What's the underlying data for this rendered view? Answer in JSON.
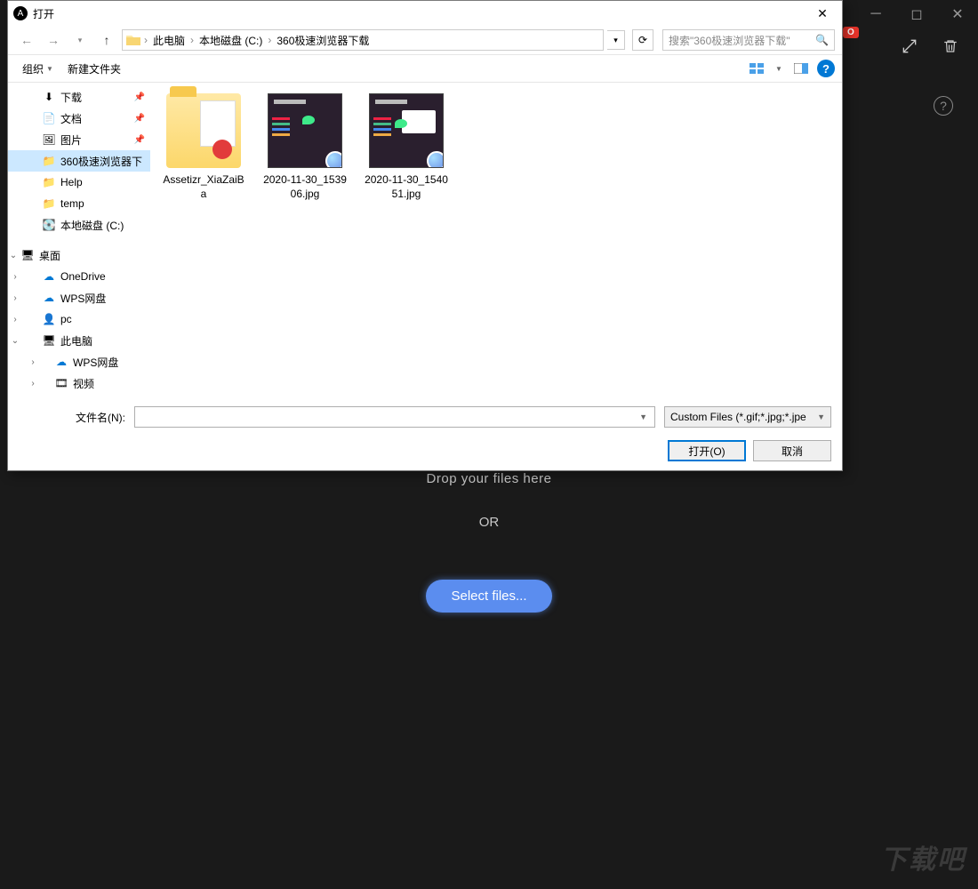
{
  "bg": {
    "pro_badge": "O",
    "drop_text": "Drop your files here",
    "or": "OR",
    "select_files": "Select files...",
    "watermark": "下载吧"
  },
  "dialog": {
    "title": "打开",
    "breadcrumb": {
      "seg0": "此电脑",
      "seg1": "本地磁盘 (C:)",
      "seg2": "360极速浏览器下载"
    },
    "search_placeholder": "搜索\"360极速浏览器下载\"",
    "toolbar": {
      "organize": "组织",
      "new_folder": "新建文件夹"
    },
    "nav": {
      "downloads": "下载",
      "documents": "文档",
      "pictures": "图片",
      "browser360": "360极速浏览器下",
      "help": "Help",
      "temp": "temp",
      "local_c": "本地磁盘 (C:)",
      "desktop": "桌面",
      "onedrive": "OneDrive",
      "wps": "WPS网盘",
      "pc": "pc",
      "thispc": "此电脑",
      "wps2": "WPS网盘",
      "video": "视频",
      "pics2": "图片"
    },
    "files": {
      "f0": "Assetizr_XiaZaiBa",
      "f1": "2020-11-30_153906.jpg",
      "f2": "2020-11-30_154051.jpg"
    },
    "footer": {
      "filename_label": "文件名(N):",
      "filter": "Custom Files (*.gif;*.jpg;*.jpe",
      "open": "打开(O)",
      "cancel": "取消"
    }
  }
}
